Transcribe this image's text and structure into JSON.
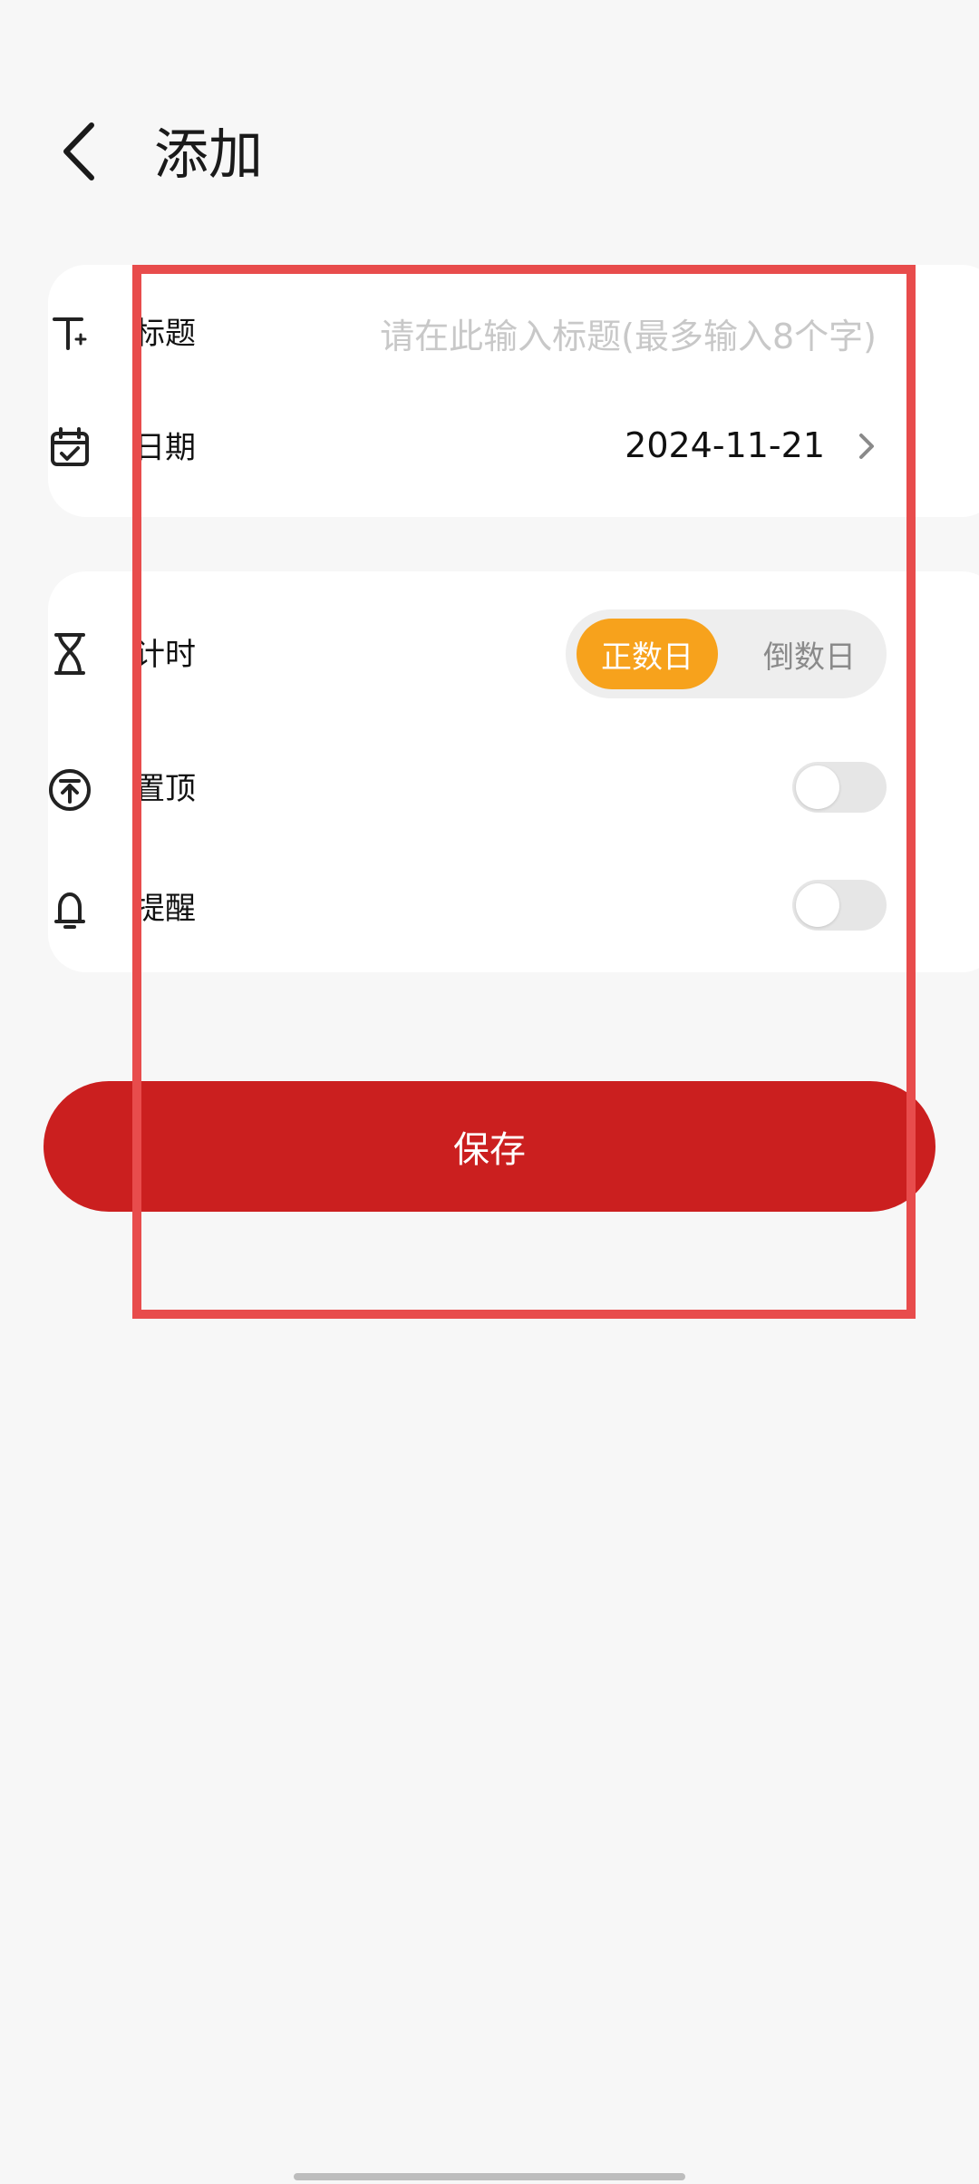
{
  "header": {
    "title": "添加"
  },
  "form": {
    "title_row": {
      "label": "标题",
      "placeholder": "请在此输入标题(最多输入8个字)",
      "value": ""
    },
    "date_row": {
      "label": "日期",
      "value": "2024-11-21"
    },
    "timer_row": {
      "label": "计时",
      "options": [
        "正数日",
        "倒数日"
      ],
      "selected": "正数日"
    },
    "pin_row": {
      "label": "置顶",
      "enabled": false
    },
    "reminder_row": {
      "label": "提醒",
      "enabled": false
    }
  },
  "actions": {
    "save_label": "保存"
  },
  "colors": {
    "accent_orange": "#f7a21c",
    "save_red": "#cb1f1f",
    "highlight_box": "#e84c4c",
    "background": "#f7f7f7"
  },
  "icons": [
    "back-arrow-icon",
    "text-icon",
    "calendar-check-icon",
    "hourglass-icon",
    "pin-top-icon",
    "bell-icon",
    "chevron-right-icon"
  ]
}
